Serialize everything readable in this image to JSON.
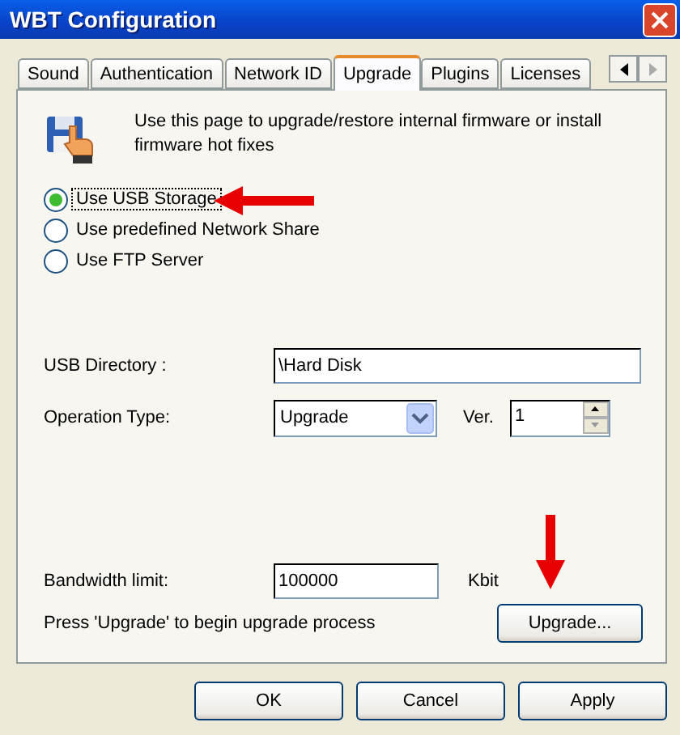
{
  "window": {
    "title": "WBT Configuration"
  },
  "tabs": [
    {
      "label": "Sound",
      "selected": false
    },
    {
      "label": "Authentication",
      "selected": false
    },
    {
      "label": "Network ID",
      "selected": false
    },
    {
      "label": "Upgrade",
      "selected": true
    },
    {
      "label": "Plugins",
      "selected": false
    },
    {
      "label": "Licenses",
      "selected": false
    }
  ],
  "description": "Use this page to upgrade/restore internal firmware  or install firmware hot fixes",
  "sources": [
    {
      "label": "Use USB Storage",
      "selected": true
    },
    {
      "label": "Use predefined Network Share",
      "selected": false
    },
    {
      "label": "Use FTP Server",
      "selected": false
    }
  ],
  "usb_directory": {
    "label": "USB Directory :",
    "value": "\\Hard Disk"
  },
  "operation_type": {
    "label": "Operation Type:",
    "value": "Upgrade"
  },
  "version": {
    "label": "Ver.",
    "value": "1"
  },
  "bandwidth": {
    "label": "Bandwidth limit:",
    "value": "100000",
    "unit": "Kbit"
  },
  "hint": "Press 'Upgrade' to  begin upgrade process",
  "upgrade_button": "Upgrade...",
  "buttons": [
    "OK",
    "Cancel",
    "Apply"
  ]
}
